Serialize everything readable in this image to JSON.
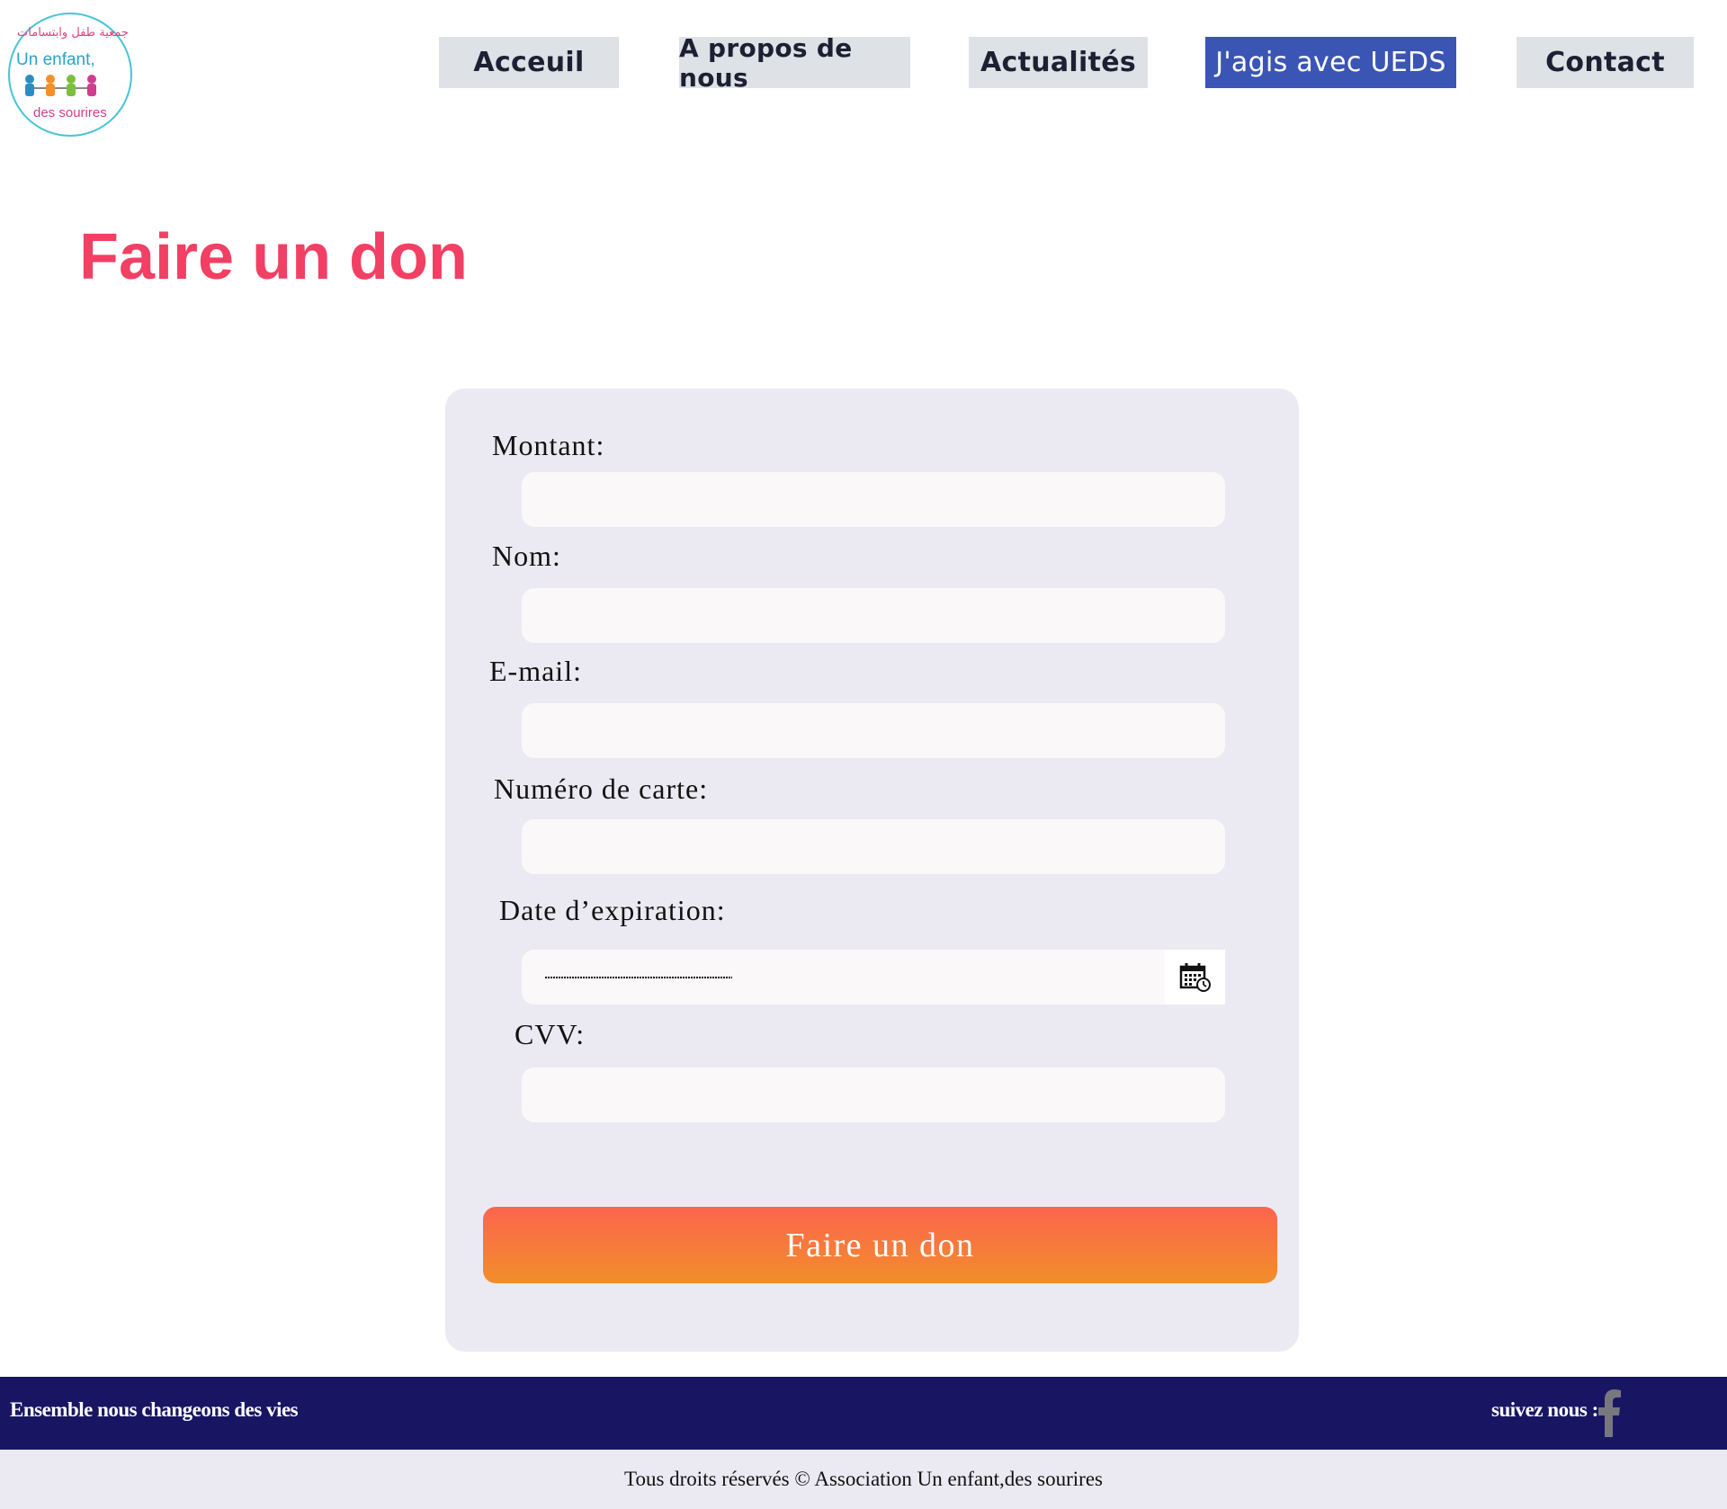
{
  "header": {
    "logo": {
      "arabic_text": "جمعية طفل وابتسامات",
      "text_line1": "Un enfant,",
      "text_line2": "des sourires"
    },
    "nav": [
      {
        "label": "Acceuil"
      },
      {
        "label": "A propos de nous"
      },
      {
        "label": "Actualités"
      },
      {
        "label": "J'agis avec UEDS",
        "active": true
      },
      {
        "label": "Contact"
      }
    ]
  },
  "main": {
    "title": "Faire un don",
    "form": {
      "amount_label": "Montant:",
      "amount_value": "",
      "name_label": "Nom:",
      "name_value": "",
      "email_label": "E-mail:",
      "email_value": "",
      "card_label": "Numéro de carte:",
      "card_value": "",
      "expiry_label": "Date d’expiration:",
      "expiry_value": "",
      "cvv_label": "CVV:",
      "cvv_value": "",
      "submit_label": "Faire un don"
    }
  },
  "footer": {
    "tagline": "Ensemble nous changeons des vies",
    "follow_label": "suivez nous :",
    "social_icon": "facebook-icon",
    "copyright": "Tous droits réservés © Association Un enfant,des sourires"
  },
  "colors": {
    "title": "#f23f64",
    "nav_active": "#3b55b5",
    "nav_default": "#dee1e5",
    "footer_bar": "#181663",
    "button_top": "#fc644e",
    "button_bottom": "#f28e2a"
  }
}
